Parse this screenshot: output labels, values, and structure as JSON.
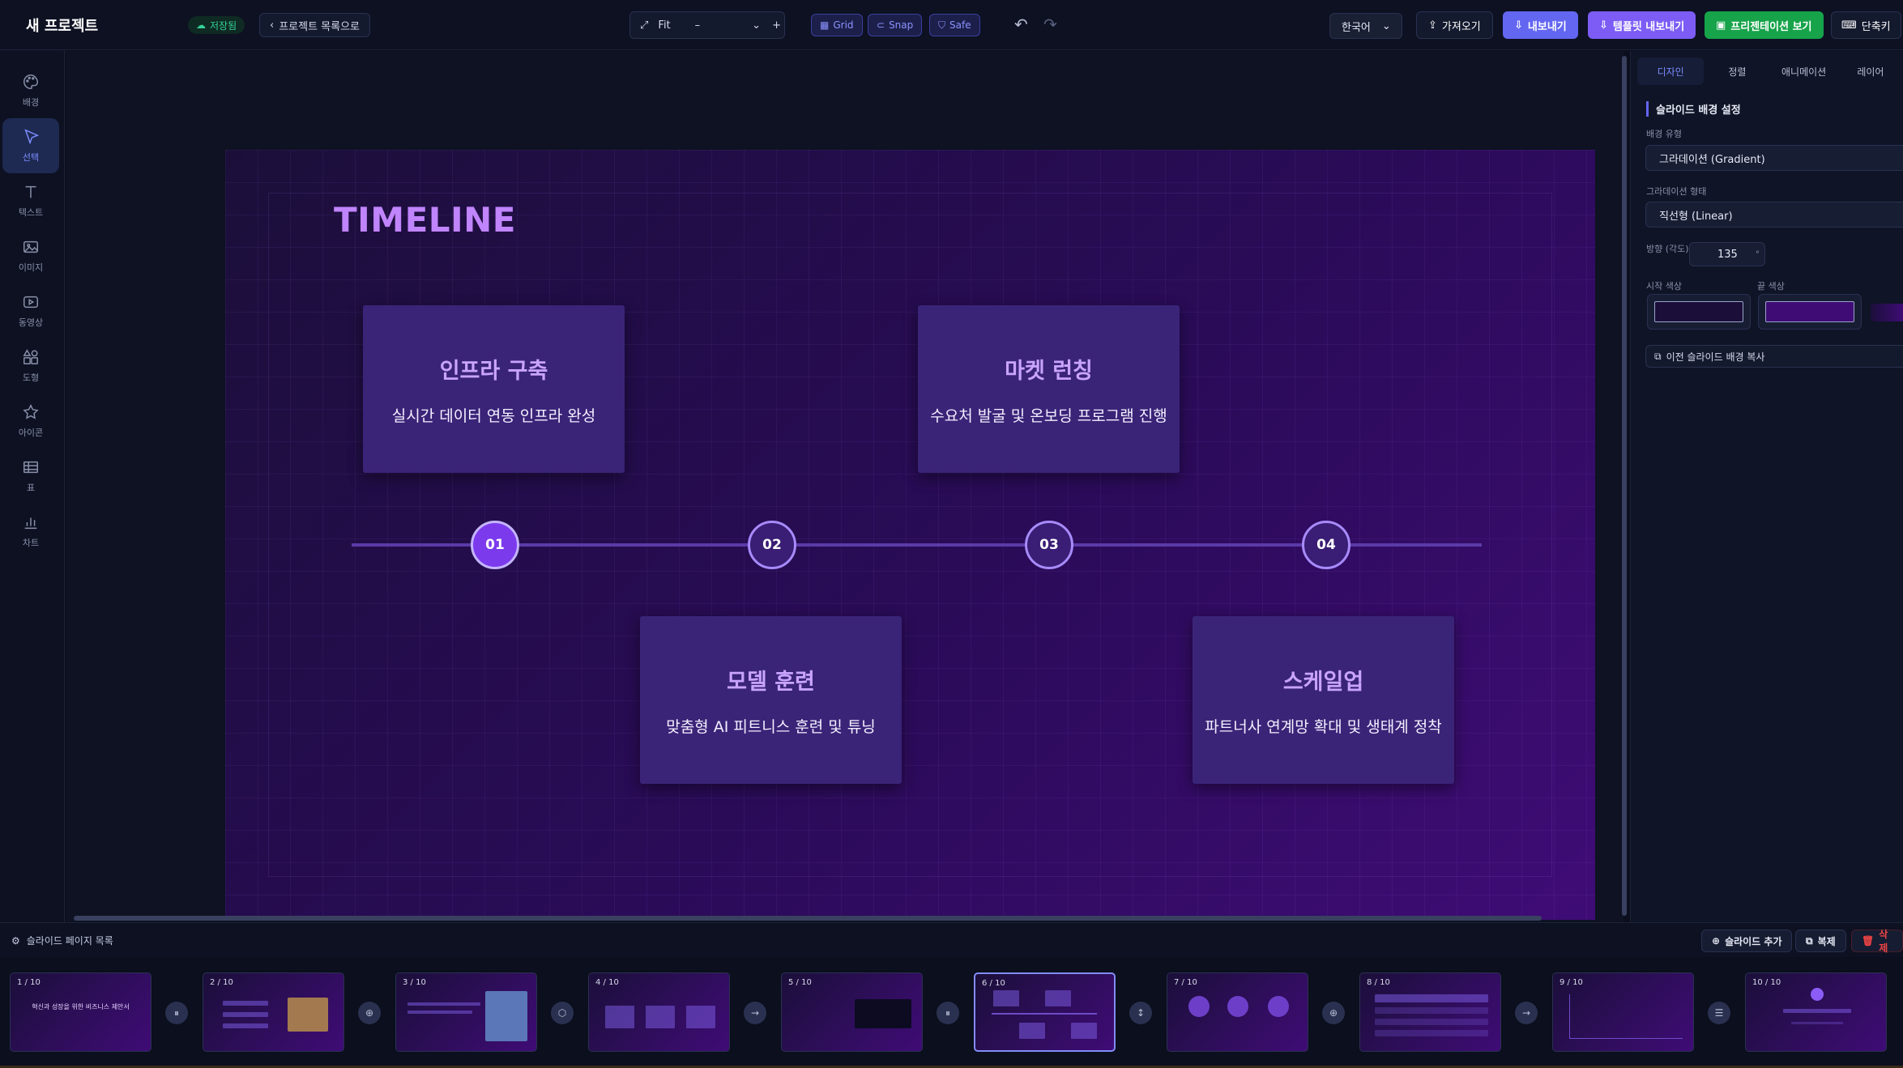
{
  "header": {
    "project_title": "새 프로젝트",
    "saved_label": "저장됨",
    "back_label": "프로젝트 목록으로",
    "zoom_label": "Fit",
    "zoom_minus": "–",
    "zoom_plus": "+",
    "toggles": {
      "grid": "Grid",
      "snap": "Snap",
      "safe": "Safe"
    },
    "language": "한국어",
    "import_label": "가져오기",
    "export_label": "내보내기",
    "template_export_label": "템플릿 내보내기",
    "present_label": "프리젠테이션 보기",
    "shortcuts_label": "단축키"
  },
  "sidebar": {
    "items": [
      {
        "label": "배경",
        "icon": "palette-icon"
      },
      {
        "label": "선택",
        "icon": "cursor-icon",
        "active": true
      },
      {
        "label": "텍스트",
        "icon": "text-icon"
      },
      {
        "label": "이미지",
        "icon": "image-icon"
      },
      {
        "label": "동영상",
        "icon": "video-icon"
      },
      {
        "label": "도형",
        "icon": "shapes-icon"
      },
      {
        "label": "아이콘",
        "icon": "star-icon"
      },
      {
        "label": "표",
        "icon": "table-icon"
      },
      {
        "label": "차트",
        "icon": "chart-icon"
      }
    ]
  },
  "slide": {
    "title": "TIMELINE",
    "cards": [
      {
        "title": "인프라 구축",
        "desc": "실시간 데이터 연동 인프라 완성"
      },
      {
        "title": "마켓 런칭",
        "desc": "수요처 발굴 및 온보딩 프로그램 진행"
      },
      {
        "title": "모델 훈련",
        "desc": "맞춤형 AI 피트니스 훈련 및 튜닝"
      },
      {
        "title": "스케일업",
        "desc": "파트너사 연계망 확대 및 생태계 정착"
      }
    ],
    "steps": [
      "01",
      "02",
      "03",
      "04"
    ]
  },
  "panel": {
    "tabs": [
      "디자인",
      "정렬",
      "애니메이션",
      "레이어"
    ],
    "section_title": "슬라이드 배경 설정",
    "bg_type_label": "배경 유형",
    "bg_type_value": "그라데이션 (Gradient)",
    "gradient_shape_label": "그라데이션 형태",
    "gradient_shape_value": "직선형 (Linear)",
    "direction_label": "방향 (각도)",
    "direction_value": "135",
    "direction_unit": "°",
    "start_color_label": "시작 색상",
    "end_color_label": "끝 색상",
    "start_color": "#1b0f3a",
    "end_color": "#3f0c76",
    "copy_prev_label": "이전 슬라이드 배경 복사"
  },
  "pages": {
    "label": "슬라이드 페이지 목록",
    "add_label": "슬라이드 추가",
    "duplicate_label": "복제",
    "delete_label": "삭제",
    "thumbs": [
      {
        "num": "1 / 10",
        "caption": "혁신과 성장을 위한 비즈니스 제안서"
      },
      {
        "num": "2 / 10",
        "caption": ""
      },
      {
        "num": "3 / 10",
        "caption": ""
      },
      {
        "num": "4 / 10",
        "caption": ""
      },
      {
        "num": "5 / 10",
        "caption": ""
      },
      {
        "num": "6 / 10",
        "caption": "",
        "active": true
      },
      {
        "num": "7 / 10",
        "caption": ""
      },
      {
        "num": "8 / 10",
        "caption": ""
      },
      {
        "num": "9 / 10",
        "caption": ""
      },
      {
        "num": "10 / 10",
        "caption": ""
      }
    ]
  },
  "colors": {
    "accent": "#6366f1",
    "present": "#16a34a",
    "delete": "#ef4444",
    "title_purple": "#c084fc"
  }
}
